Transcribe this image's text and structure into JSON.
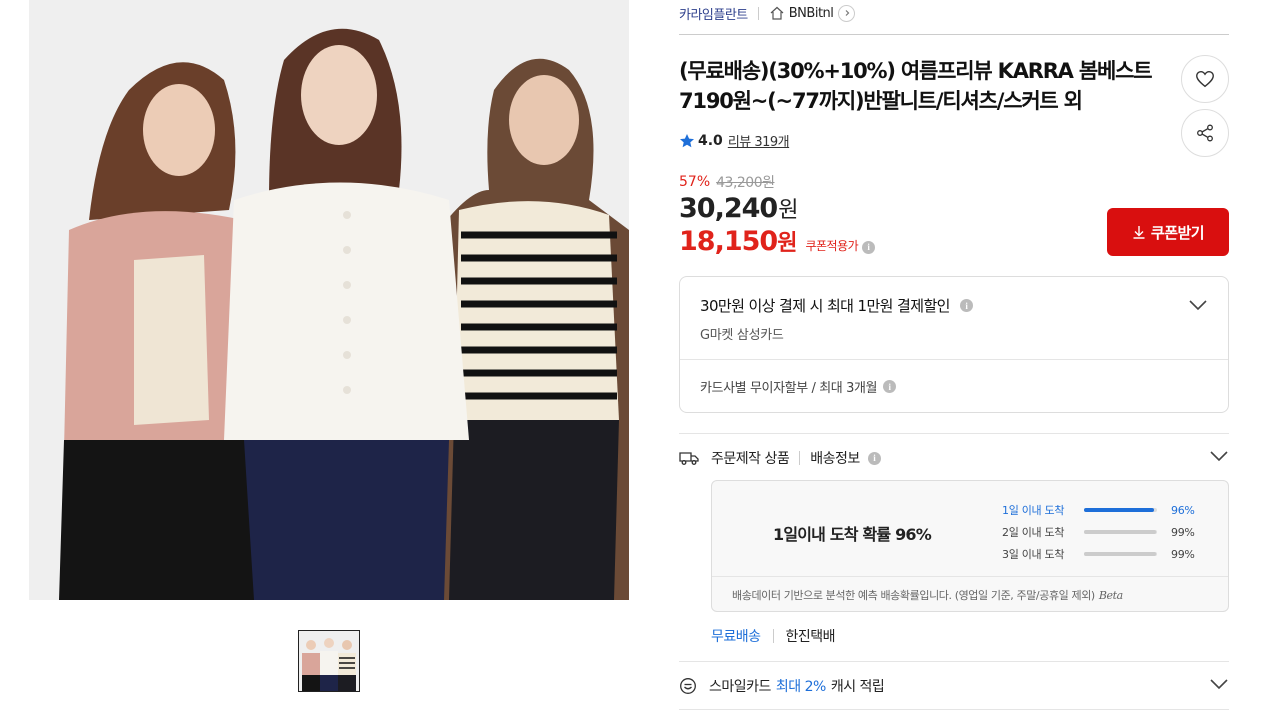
{
  "gallery": {
    "main_image": "models-knitwear-photo",
    "thumbnail": "models-knitwear-thumb"
  },
  "shop": {
    "name": "카라임플란트",
    "brand": "BNBitnl"
  },
  "product": {
    "title": "(무료배송)(30%+10%) 여름프리뷰 KARRA 봄베스트 7190원~(~77까지)반팔니트/티셔츠/스커트 외",
    "rating": "4.0",
    "review_label": "리뷰 319개"
  },
  "price": {
    "discount_rate": "57%",
    "original": "43,200원",
    "sale": "30,240",
    "sale_unit": "원",
    "coupon_price": "18,150",
    "coupon_unit": "원",
    "coupon_applied_label": "쿠폰적용가",
    "coupon_button": "쿠폰받기"
  },
  "card_benefit": {
    "main": "30만원 이상 결제 시 최대 1만원 결제할인",
    "card_name": "G마켓 삼성카드",
    "installment": "카드사별 무이자할부 / 최대 3개월"
  },
  "shipping": {
    "made_to_order": "주문제작 상품",
    "info_label": "배송정보",
    "headline": "1일이내 도착 확률 96%",
    "probabilities": [
      {
        "label": "1일 이내 도착",
        "value": 96,
        "text": "96%",
        "active": true
      },
      {
        "label": "2일 이내 도착",
        "value": 99,
        "text": "99%",
        "active": false
      },
      {
        "label": "3일 이내 도착",
        "value": 99,
        "text": "99%",
        "active": false
      }
    ],
    "note": "배송데이터 기반으로 분석한 예측 배송확률입니다. (영업일 기준, 주말/공휴일 제외)",
    "beta": "Beta",
    "free_label": "무료배송",
    "carrier": "한진택배"
  },
  "smile": {
    "prefix": "스마일카드",
    "highlight": "최대 2%",
    "suffix": "캐시 적립"
  },
  "colors": {
    "accent_red": "#d90f0f",
    "discount_red": "#e0231b",
    "link_blue": "#1e6fd9",
    "shop_blue": "#2d3f8c"
  }
}
